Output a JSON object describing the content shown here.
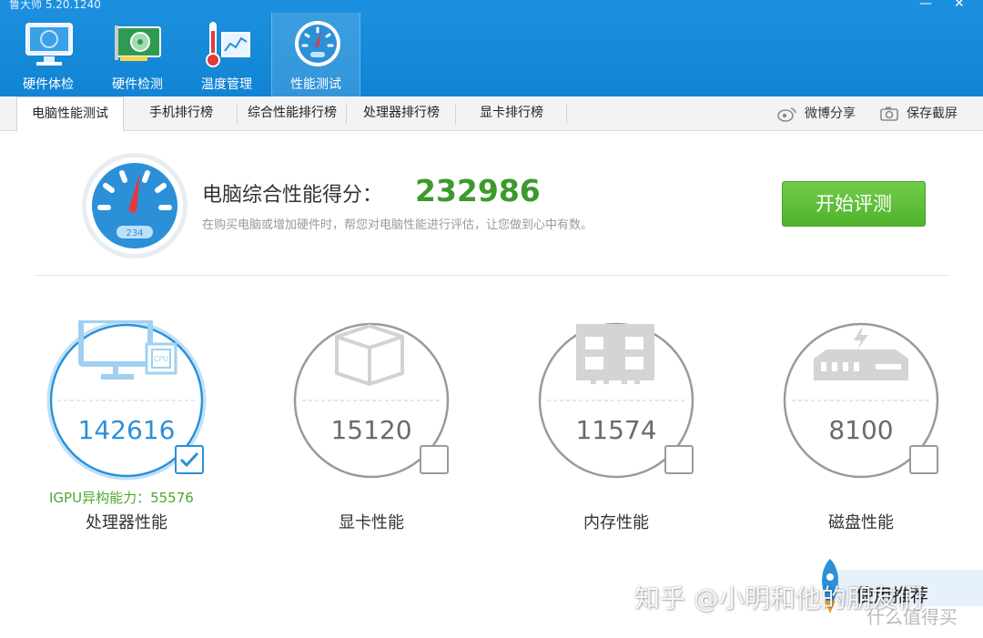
{
  "window": {
    "title": "鲁大师 5.20.1240",
    "controls": {
      "minimize": "—",
      "close": "✕"
    }
  },
  "nav": [
    {
      "label": "硬件体检",
      "icon": "monitor-icon"
    },
    {
      "label": "硬件检测",
      "icon": "graphics-card-icon"
    },
    {
      "label": "温度管理",
      "icon": "thermometer-icon"
    },
    {
      "label": "性能测试",
      "icon": "speedometer-icon",
      "active": true
    }
  ],
  "tabs": [
    {
      "label": "电脑性能测试",
      "active": true
    },
    {
      "label": "手机排行榜"
    },
    {
      "label": "综合性能排行榜"
    },
    {
      "label": "处理器排行榜"
    },
    {
      "label": "显卡排行榜"
    }
  ],
  "share": {
    "weibo_label": "微博分享",
    "screenshot_label": "保存截屏"
  },
  "score": {
    "label": "电脑综合性能得分：",
    "value": "232986",
    "description": "在购买电脑或增加硬件时，帮您对电脑性能进行评估，让您做到心中有数。",
    "gauge_readout": "234",
    "start_button": "开始评测"
  },
  "metrics": [
    {
      "name": "处理器性能",
      "value": "142616",
      "checked": true,
      "icon": "cpu-monitor-icon",
      "extra": "IGPU异构能力：55576"
    },
    {
      "name": "显卡性能",
      "value": "15120",
      "checked": false,
      "icon": "cube-icon"
    },
    {
      "name": "内存性能",
      "value": "11574",
      "checked": false,
      "icon": "memory-icon"
    },
    {
      "name": "磁盘性能",
      "value": "8100",
      "checked": false,
      "icon": "disk-icon"
    }
  ],
  "watermark": {
    "text": "知乎 @小明和他的朋友们",
    "badge": "使用推荐",
    "badge_sub": "什么值得买"
  },
  "colors": {
    "header_blue": "#168ad8",
    "score_green": "#3c9a2c",
    "button_green": "#5bbd36",
    "accent_blue": "#2b90d8"
  }
}
